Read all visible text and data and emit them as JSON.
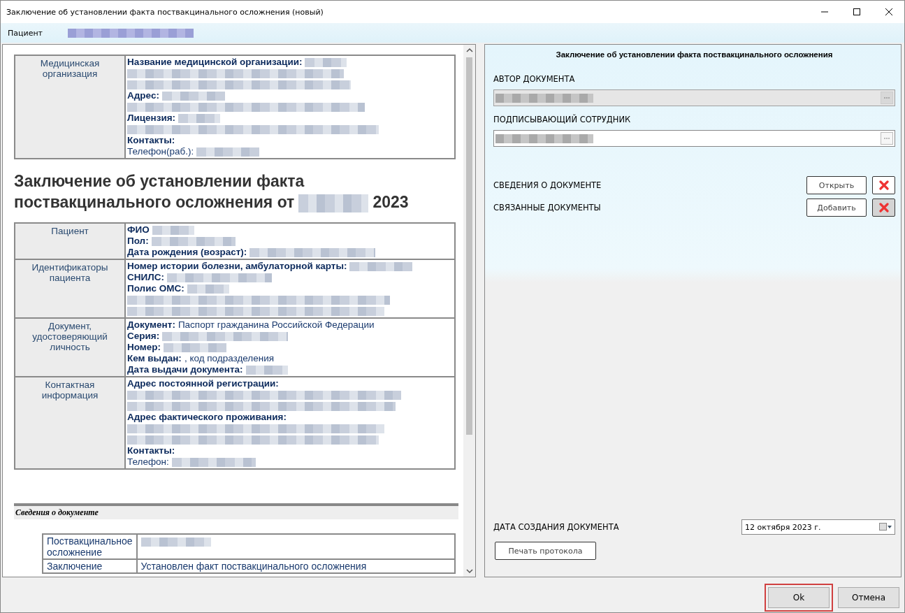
{
  "window": {
    "title": "Заключение об установлении факта поствакцинального осложнения (новый)"
  },
  "patient_bar": {
    "label": "Пациент",
    "value_redacted": true
  },
  "document": {
    "org_table": [
      {
        "label": "Медицинская организация",
        "lines": [
          {
            "kind": "field",
            "key": "Название медицинской организации:",
            "redacted": true
          },
          {
            "kind": "redacted"
          },
          {
            "kind": "redacted"
          },
          {
            "kind": "field",
            "key": "Адрес:",
            "redacted": true
          },
          {
            "kind": "redacted"
          },
          {
            "kind": "field",
            "key": "Лицензия:",
            "redacted": true
          },
          {
            "kind": "redacted"
          },
          {
            "kind": "field",
            "key": "Контакты:"
          },
          {
            "kind": "field",
            "value": "Телефон(раб.):",
            "redacted": true
          }
        ]
      }
    ],
    "heading": {
      "text": "Заключение об установлении факта поствакцинального осложнения от",
      "date_redacted": true,
      "year": "2023"
    },
    "patient_table": [
      {
        "label": "Пациент",
        "lines": [
          {
            "kind": "field",
            "key": "ФИО",
            "redacted": true
          },
          {
            "kind": "field",
            "key": "Пол:",
            "redacted": true
          },
          {
            "kind": "field",
            "key": "Дата рождения (возраст):",
            "redacted": true
          }
        ]
      },
      {
        "label": "Идентификаторы пациента",
        "lines": [
          {
            "kind": "field",
            "key": "Номер истории болезни, амбулаторной карты:",
            "redacted": true
          },
          {
            "kind": "field",
            "key": "СНИЛС:",
            "redacted": true
          },
          {
            "kind": "field",
            "key": "Полис ОМС:",
            "redacted": true
          },
          {
            "kind": "redacted"
          },
          {
            "kind": "redacted"
          }
        ]
      },
      {
        "label": "Документ, удостоверяющий личность",
        "lines": [
          {
            "kind": "field",
            "key": "Документ:",
            "value": "Паспорт гражданина Российской Федерации"
          },
          {
            "kind": "field",
            "key": "Серия:",
            "redacted": true
          },
          {
            "kind": "field",
            "key": "Номер:",
            "redacted": true
          },
          {
            "kind": "field",
            "key": "Кем выдан:",
            "value": ", код подразделения"
          },
          {
            "kind": "field",
            "key": "Дата выдачи документа:",
            "redacted": true
          }
        ]
      },
      {
        "label": "Контактная информация",
        "lines": [
          {
            "kind": "field",
            "key": "Адрес постоянной регистрации:"
          },
          {
            "kind": "redacted"
          },
          {
            "kind": "redacted"
          },
          {
            "kind": "field",
            "key": "Адрес фактического проживания:"
          },
          {
            "kind": "redacted"
          },
          {
            "kind": "redacted"
          },
          {
            "kind": "field",
            "key": "Контакты:"
          },
          {
            "kind": "field",
            "value": "Телефон:",
            "redacted": true
          }
        ]
      }
    ],
    "section_title": "Сведения о документе",
    "details_table": [
      {
        "label": "Поствакцинальное осложнение",
        "redacted": true
      },
      {
        "label": "Заключение",
        "value": "Установлен факт поствакцинального осложнения"
      }
    ]
  },
  "form": {
    "title": "Заключение об установлении факта поствакцинального осложнения",
    "fields": [
      {
        "label": "АВТОР ДОКУМЕНТА",
        "redacted": true,
        "disabled": true
      },
      {
        "label": "ПОДПИСЫВАЮЩИЙ СОТРУДНИК",
        "redacted": true,
        "disabled": false
      }
    ],
    "actions": [
      {
        "label": "СВЕДЕНИЯ О ДОКУМЕНТЕ",
        "button": "Открыть",
        "delete_pressed": false
      },
      {
        "label": "СВЯЗАННЫЕ ДОКУМЕНТЫ",
        "button": "Добавить",
        "delete_pressed": true
      }
    ],
    "date_label": "ДАТА СОЗДАНИЯ ДОКУМЕНТА",
    "date_value": "12  октября  2023 г.",
    "print_button": "Печать протокола"
  },
  "buttons": [
    {
      "label": "Ok",
      "highlighted": true
    },
    {
      "label": "Отмена",
      "highlighted": false
    }
  ]
}
